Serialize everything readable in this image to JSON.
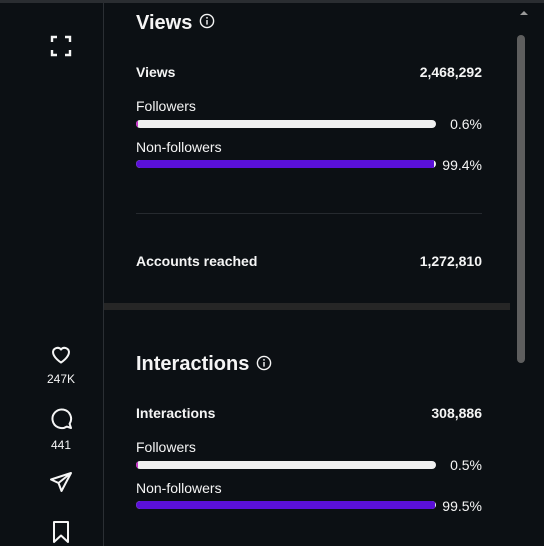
{
  "rail": {
    "like_count": "247K",
    "comment_count": "441"
  },
  "views": {
    "heading": "Views",
    "total_label": "Views",
    "total_value": "2,468,292",
    "followers_label": "Followers",
    "followers_pct": "0.6%",
    "followers_fraction": 0.006,
    "nonfollowers_label": "Non-followers",
    "nonfollowers_pct": "99.4%",
    "nonfollowers_fraction": 0.994,
    "reached_label": "Accounts reached",
    "reached_value": "1,272,810"
  },
  "interactions": {
    "heading": "Interactions",
    "total_label": "Interactions",
    "total_value": "308,886",
    "followers_label": "Followers",
    "followers_pct": "0.5%",
    "followers_fraction": 0.005,
    "nonfollowers_label": "Non-followers",
    "nonfollowers_pct": "99.5%",
    "nonfollowers_fraction": 0.995
  },
  "colors": {
    "background": "#0c1014",
    "followers_bar": "#c833c8",
    "nonfollowers_bar": "#5a10d8",
    "bar_track": "#f1f1f1"
  }
}
